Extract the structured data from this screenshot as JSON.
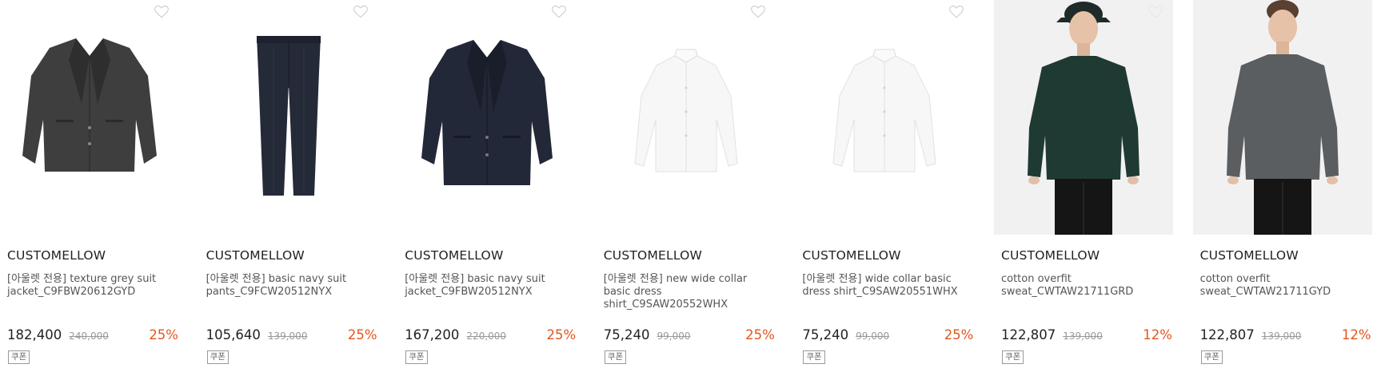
{
  "products": [
    {
      "brand": "CUSTOMELLOW",
      "name": "[아울렛 전용] texture grey suit jacket_C9FBW20612GYD",
      "price": "182,400",
      "original_price": "240,000",
      "discount": "25%",
      "coupon": "쿠폰",
      "image": "grey-suit-jacket",
      "color": "#3e3e3e"
    },
    {
      "brand": "CUSTOMELLOW",
      "name": "[아울렛 전용] basic navy suit pants_C9FCW20512NYX",
      "price": "105,640",
      "original_price": "139,000",
      "discount": "25%",
      "coupon": "쿠폰",
      "image": "navy-suit-pants",
      "color": "#252a38"
    },
    {
      "brand": "CUSTOMELLOW",
      "name": "[아울렛 전용] basic navy suit jacket_C9FBW20512NYX",
      "price": "167,200",
      "original_price": "220,000",
      "discount": "25%",
      "coupon": "쿠폰",
      "image": "navy-suit-jacket",
      "color": "#232838"
    },
    {
      "brand": "CUSTOMELLOW",
      "name": "[아울렛 전용] new wide collar basic dress shirt_C9SAW20552WHX",
      "price": "75,240",
      "original_price": "99,000",
      "discount": "25%",
      "coupon": "쿠폰",
      "image": "white-dress-shirt",
      "color": "#f7f7f7"
    },
    {
      "brand": "CUSTOMELLOW",
      "name": "[아울렛 전용] wide collar basic dress shirt_C9SAW20551WHX",
      "price": "75,240",
      "original_price": "99,000",
      "discount": "25%",
      "coupon": "쿠폰",
      "image": "white-dress-shirt",
      "color": "#f7f7f7"
    },
    {
      "brand": "CUSTOMELLOW",
      "name": "cotton overfit sweat_CWTAW21711GRD",
      "price": "122,807",
      "original_price": "139,000",
      "discount": "12%",
      "coupon": "쿠폰",
      "image": "model-green-sweatshirt",
      "color": "#1f3a33"
    },
    {
      "brand": "CUSTOMELLOW",
      "name": "cotton overfit sweat_CWTAW21711GYD",
      "price": "122,807",
      "original_price": "139,000",
      "discount": "12%",
      "coupon": "쿠폰",
      "image": "model-grey-sweatshirt",
      "color": "#5b5e61"
    }
  ],
  "icons": {
    "wishlist": "heart-outline-icon"
  }
}
